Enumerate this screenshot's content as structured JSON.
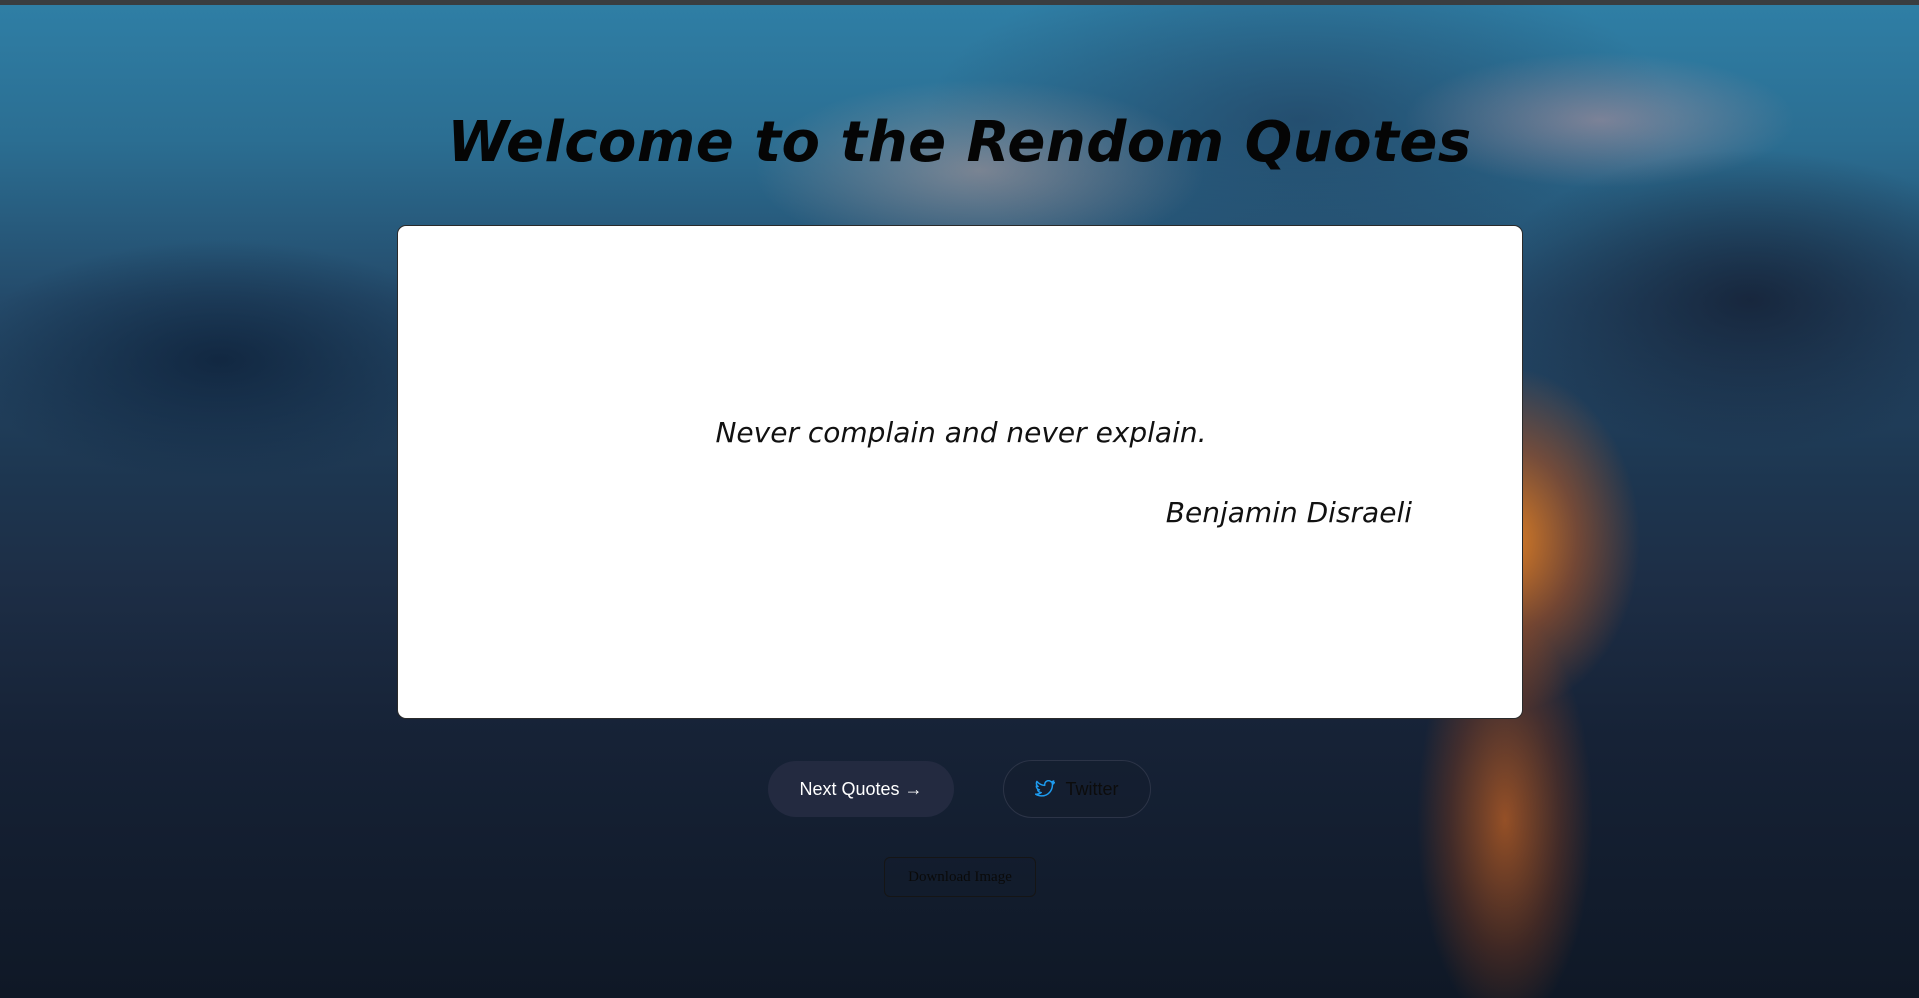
{
  "page": {
    "title": "Welcome to the Rendom Quotes"
  },
  "quote": {
    "text": "Never complain and never explain.",
    "author": "Benjamin Disraeli"
  },
  "actions": {
    "next_label": "Next Quotes →",
    "twitter_label": "Twitter",
    "download_label": "Download Image"
  },
  "icons": {
    "twitter": "twitter-bird-icon"
  },
  "colors": {
    "next_button_bg": "#232a40",
    "twitter_icon": "#1d9bf0",
    "card_bg": "#ffffff"
  }
}
